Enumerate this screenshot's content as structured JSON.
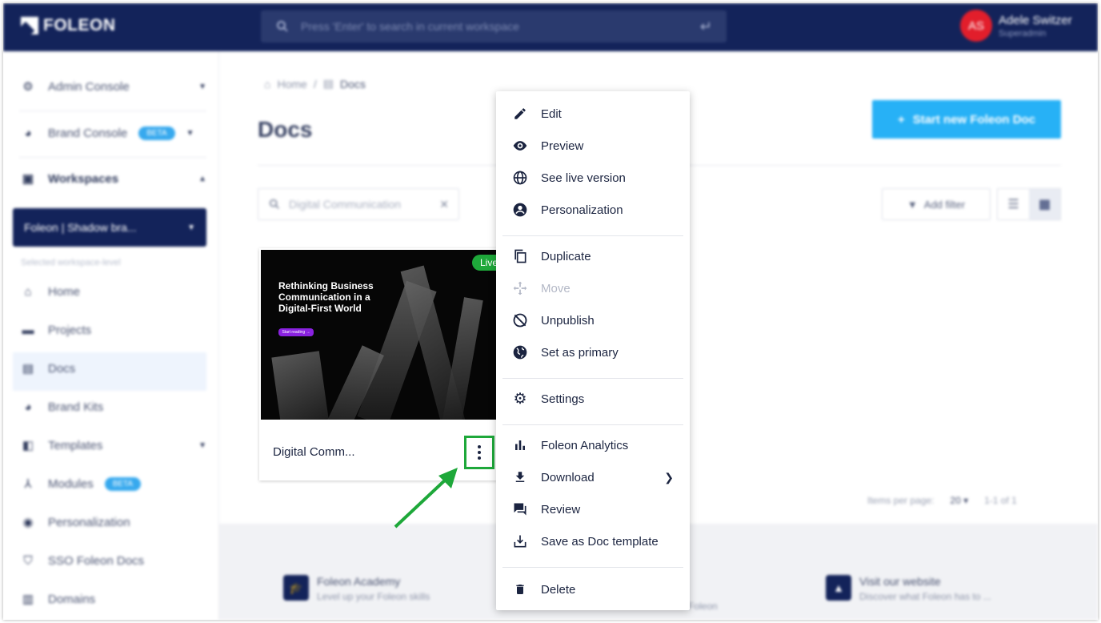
{
  "header": {
    "logo_text": "FOLEON",
    "search_placeholder": "Press 'Enter' to search in current workspace",
    "user_initials": "AS",
    "user_name": "Adele Switzer",
    "user_role": "Superadmin"
  },
  "sidebar": {
    "admin_console": "Admin Console",
    "brand_console": "Brand Console",
    "beta_label": "BETA",
    "workspaces": "Workspaces",
    "workspace_selected": "Foleon | Shadow bra...",
    "workspace_note": "Selected workspace-level",
    "items": [
      "Home",
      "Projects",
      "Docs",
      "Brand Kits",
      "Templates",
      "Modules",
      "Personalization",
      "SSO Foleon Docs",
      "Domains"
    ]
  },
  "main": {
    "breadcrumb_home": "Home",
    "breadcrumb_sep": "/",
    "breadcrumb_current": "Docs",
    "page_title": "Docs",
    "start_button": "Start new Foleon Doc",
    "search_value": "Digital Communication",
    "add_filter": "Add filter",
    "items_per_page_label": "Items per page:",
    "items_per_page_value": "20",
    "range": "1-1 of 1"
  },
  "card": {
    "live_badge": "Live",
    "thumb_title": "Rethinking Business Communication in a Digital-First World",
    "thumb_button": "Start reading →",
    "name": "Digital Comm..."
  },
  "menu": {
    "edit": "Edit",
    "preview": "Preview",
    "see_live": "See live version",
    "personalization": "Personalization",
    "duplicate": "Duplicate",
    "move": "Move",
    "unpublish": "Unpublish",
    "set_primary": "Set as primary",
    "settings": "Settings",
    "analytics": "Foleon Analytics",
    "download": "Download",
    "review": "Review",
    "save_template": "Save as Doc template",
    "delete": "Delete"
  },
  "footer": {
    "academy_title": "Foleon Academy",
    "academy_sub": "Level up your Foleon skills",
    "middle_sub": "Foleon",
    "website_title": "Visit our website",
    "website_sub": "Discover what Foleon has to ..."
  },
  "colors": {
    "navy": "#13235a",
    "accent_blue": "#27b1f6",
    "live_green": "#1ea83a",
    "avatar_red": "#e21e2b"
  }
}
